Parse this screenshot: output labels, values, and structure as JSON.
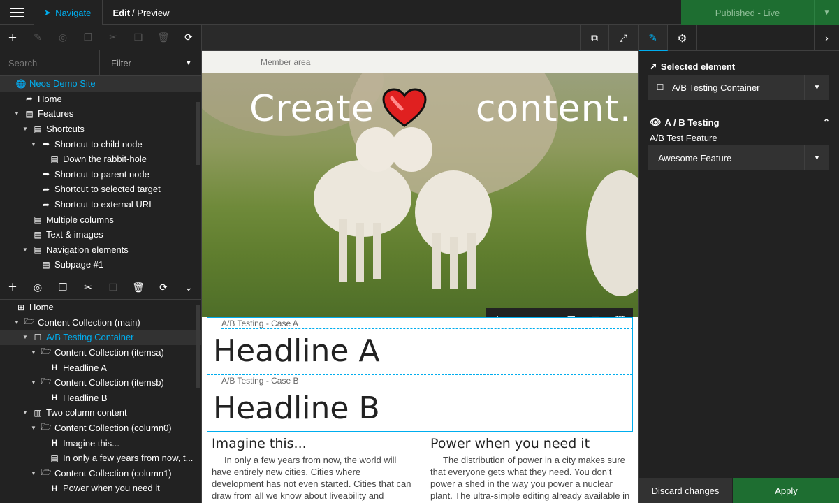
{
  "topbar": {
    "navigate_label": "Navigate",
    "edit_label": "Edit",
    "preview_label": "/ Preview",
    "publish_label": "Published - Live"
  },
  "left": {
    "search_placeholder": "Search",
    "filter_label": "Filter",
    "page_tree": [
      {
        "label": "Neos Demo Site",
        "icon": "globe-icon",
        "depth": 0,
        "toggle": "",
        "active": true,
        "blue": true
      },
      {
        "label": "Home",
        "icon": "shortcut-icon",
        "depth": 1,
        "toggle": ""
      },
      {
        "label": "Features",
        "icon": "document-icon",
        "depth": 1,
        "toggle": "▼"
      },
      {
        "label": "Shortcuts",
        "icon": "document-icon",
        "depth": 2,
        "toggle": "▼"
      },
      {
        "label": "Shortcut to child node",
        "icon": "shortcut-icon",
        "depth": 3,
        "toggle": "▼"
      },
      {
        "label": "Down the rabbit-hole",
        "icon": "document-icon",
        "depth": 4,
        "toggle": ""
      },
      {
        "label": "Shortcut to parent node",
        "icon": "shortcut-icon",
        "depth": 3,
        "toggle": ""
      },
      {
        "label": "Shortcut to selected target",
        "icon": "shortcut-icon",
        "depth": 3,
        "toggle": ""
      },
      {
        "label": "Shortcut to external URI",
        "icon": "shortcut-icon",
        "depth": 3,
        "toggle": ""
      },
      {
        "label": "Multiple columns",
        "icon": "document-icon",
        "depth": 2,
        "toggle": ""
      },
      {
        "label": "Text & images",
        "icon": "document-icon",
        "depth": 2,
        "toggle": ""
      },
      {
        "label": "Navigation elements",
        "icon": "document-icon",
        "depth": 2,
        "toggle": "▼"
      },
      {
        "label": "Subpage #1",
        "icon": "document-icon",
        "depth": 3,
        "toggle": ""
      }
    ],
    "content_tree": [
      {
        "label": "Home",
        "icon": "sitemap-icon",
        "depth": 0,
        "toggle": ""
      },
      {
        "label": "Content Collection (main)",
        "icon": "folder-open-icon",
        "depth": 1,
        "toggle": "▼"
      },
      {
        "label": "A/B Testing Container",
        "icon": "square-icon",
        "depth": 2,
        "toggle": "▼",
        "active": true,
        "blue": true
      },
      {
        "label": "Content Collection (itemsa)",
        "icon": "folder-open-icon",
        "depth": 3,
        "toggle": "▼"
      },
      {
        "label": "Headline A",
        "icon": "heading-icon",
        "depth": 4,
        "toggle": ""
      },
      {
        "label": "Content Collection (itemsb)",
        "icon": "folder-open-icon",
        "depth": 3,
        "toggle": "▼"
      },
      {
        "label": "Headline B",
        "icon": "heading-icon",
        "depth": 4,
        "toggle": ""
      },
      {
        "label": "Two column content",
        "icon": "columns-icon",
        "depth": 2,
        "toggle": "▼"
      },
      {
        "label": "Content Collection (column0)",
        "icon": "folder-open-icon",
        "depth": 3,
        "toggle": "▼"
      },
      {
        "label": "Imagine this...",
        "icon": "heading-icon",
        "depth": 4,
        "toggle": ""
      },
      {
        "label": "In only a few years from now, t...",
        "icon": "document-icon",
        "depth": 4,
        "toggle": ""
      },
      {
        "label": "Content Collection (column1)",
        "icon": "folder-open-icon",
        "depth": 3,
        "toggle": "▼"
      },
      {
        "label": "Power when you need it",
        "icon": "heading-icon",
        "depth": 4,
        "toggle": ""
      }
    ]
  },
  "canvas": {
    "member_area": "Member area",
    "hero_title_left": "Create",
    "hero_title_right": "content.",
    "case_a_label": "A/B Testing - Case A",
    "headline_a": "Headline A",
    "case_b_label": "A/B Testing - Case B",
    "headline_b": "Headline B",
    "col1_title": "Imagine this...",
    "col1_text": "In only a few years from now, the world will have entirely new cities. Cities where development has not even started. Cities that can draw from all we know about liveability and functionality.",
    "col2_title": "Power when you need it",
    "col2_text": "The distribution of power in a city makes sure that everyone gets what they need. You don’t power a shed in the way you power a nuclear plant. The ultra-simple editing already available in the claim makes it"
  },
  "inspector": {
    "selected_title": "Selected element",
    "selected_value": "A/B Testing Container",
    "group_title": "A / B Testing",
    "field_label": "A/B Test Feature",
    "field_value": "Awesome Feature",
    "discard_label": "Discard changes",
    "apply_label": "Apply"
  },
  "colors": {
    "accent": "#00adee",
    "publish_green": "#1e6e31",
    "panel_bg": "#222222"
  }
}
